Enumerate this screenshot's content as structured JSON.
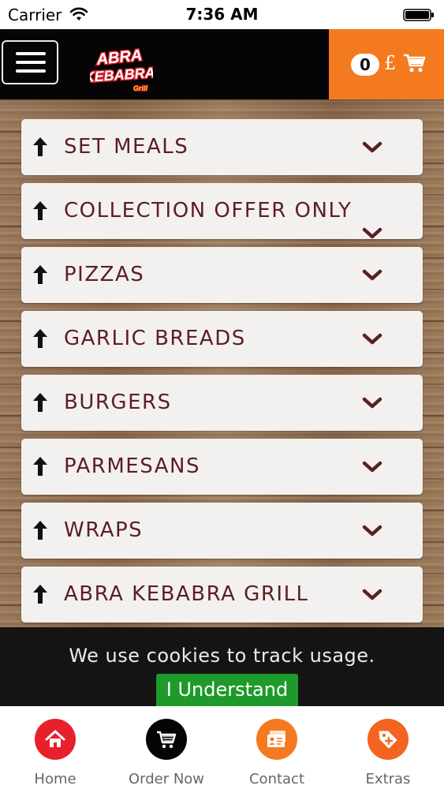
{
  "status_bar": {
    "carrier": "Carrier",
    "time": "7:36 AM"
  },
  "header": {
    "logo_text_line1": "ABRA",
    "logo_text_line2": "KEBABRA",
    "logo_text_line3": "Grill",
    "cart_count": "0",
    "cart_currency": "£",
    "cart_color": "#f47a20"
  },
  "menu": {
    "categories": [
      {
        "label": "SET MEALS"
      },
      {
        "label": "COLLECTION OFFER ONLY"
      },
      {
        "label": "PIZZAS"
      },
      {
        "label": "GARLIC BREADS"
      },
      {
        "label": "BURGERS"
      },
      {
        "label": "PARMESANS"
      },
      {
        "label": "WRAPS"
      },
      {
        "label": "ABRA KEBABRA GRILL"
      }
    ],
    "label_color": "#5a1f24"
  },
  "cookie_banner": {
    "message": "We use cookies to track usage.",
    "button_label": "I Understand",
    "button_color": "#1e9a2a"
  },
  "tab_bar": {
    "tabs": [
      {
        "label": "Home",
        "icon": "home-icon",
        "color": "#e8202b"
      },
      {
        "label": "Order Now",
        "icon": "cart-icon",
        "color": "#050505"
      },
      {
        "label": "Contact",
        "icon": "contact-card-icon",
        "color": "#f47a20"
      },
      {
        "label": "Extras",
        "icon": "tag-icon",
        "color": "#f4631f"
      }
    ]
  }
}
